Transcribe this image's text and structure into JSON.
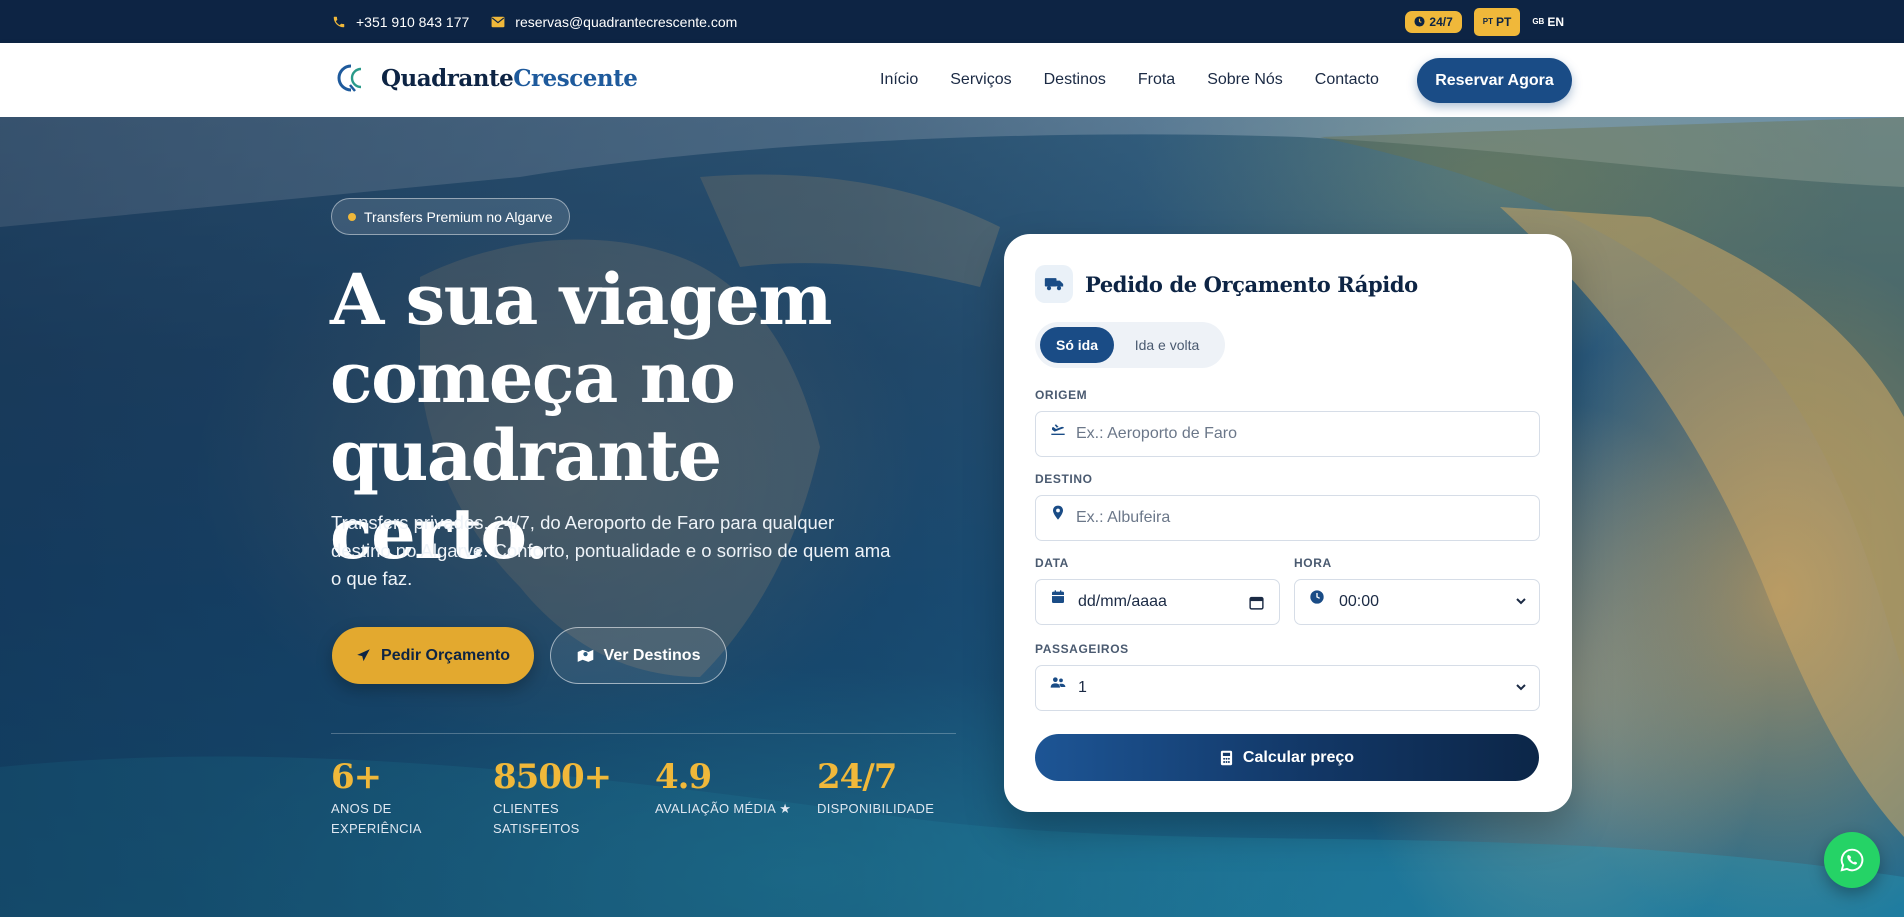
{
  "topbar": {
    "phone": "+351 910 843 177",
    "email": "reservas@quadrantecrescente.com",
    "badge_247": "24/7",
    "lang_pt_flag": "PT",
    "lang_pt": "PT",
    "lang_en_flag": "GB",
    "lang_en": "EN"
  },
  "nav": {
    "brand_part1": "Quadrante",
    "brand_part2": "Crescente",
    "links": [
      "Início",
      "Serviços",
      "Destinos",
      "Frota",
      "Sobre Nós",
      "Contacto"
    ],
    "cta": "Reservar Agora"
  },
  "hero": {
    "pill": "Transfers Premium no Algarve",
    "headline_line1": "A sua viagem",
    "headline_line2": "começa no",
    "headline_line3": "quadrante certo.",
    "subtext": "Transfers privados, 24/7, do Aeroporto de Faro para qualquer destino no Algarve. Conforto, pontualidade e o sorriso de quem ama o que faz.",
    "btn_quote": "Pedir Orçamento",
    "btn_destinations": "Ver Destinos",
    "stats": [
      {
        "value": "6+",
        "label": "ANOS DE EXPERIÊNCIA"
      },
      {
        "value": "8500+",
        "label": "CLIENTES SATISFEITOS"
      },
      {
        "value": "4.9",
        "label": "AVALIAÇÃO MÉDIA ★"
      },
      {
        "value": "24/7",
        "label": "DISPONIBILIDADE"
      }
    ]
  },
  "form": {
    "title": "Pedido de Orçamento Rápido",
    "trip_one_way": "Só ida",
    "trip_round": "Ida e volta",
    "origin_label": "ORIGEM",
    "origin_placeholder": "Ex.: Aeroporto de Faro",
    "destination_label": "DESTINO",
    "destination_placeholder": "Ex.: Albufeira",
    "date_label": "DATA",
    "date_value": "dd/mm/aaaa",
    "time_label": "HORA",
    "time_value": "00:00",
    "passengers_label": "PASSAGEIROS",
    "passengers_value": "1",
    "submit": "Calcular preço"
  },
  "colors": {
    "navy": "#0d2444",
    "primary": "#1a4c86",
    "accent": "#f0b83a",
    "whatsapp": "#25d366"
  },
  "icons": [
    "phone-icon",
    "mail-icon",
    "clock-icon",
    "truck-icon",
    "plane-icon",
    "map-pin-icon",
    "calendar-icon",
    "users-icon",
    "send-icon",
    "map-icon",
    "calculator-icon",
    "whatsapp-icon"
  ]
}
